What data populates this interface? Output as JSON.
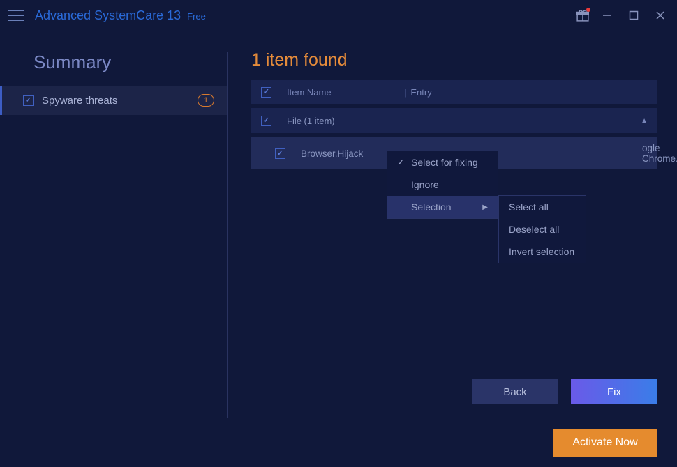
{
  "titlebar": {
    "app_name": "Advanced SystemCare 13",
    "edition": "Free"
  },
  "sidebar": {
    "title": "Summary",
    "items": [
      {
        "label": "Spyware threats",
        "count": "1",
        "checked": true
      }
    ]
  },
  "content": {
    "heading": "1 item found",
    "columns": {
      "name": "Item Name",
      "entry": "Entry"
    },
    "group": {
      "label": "File (1 item)"
    },
    "items": [
      {
        "name": "Browser.Hijack",
        "entry_visible": "ogle Chrome.lnk",
        "checked": true
      }
    ],
    "buttons": {
      "back": "Back",
      "fix": "Fix"
    }
  },
  "context_menu": {
    "select_fixing": "Select for fixing",
    "ignore": "Ignore",
    "selection": "Selection",
    "submenu": {
      "select_all": "Select all",
      "deselect_all": "Deselect all",
      "invert": "Invert selection"
    }
  },
  "footer": {
    "activate": "Activate Now"
  }
}
